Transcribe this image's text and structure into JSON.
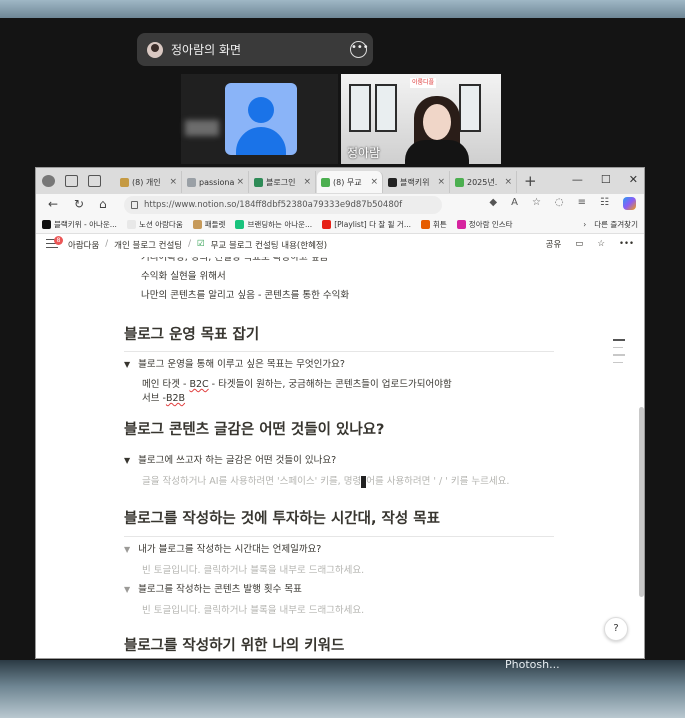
{
  "meeting": {
    "presenter_label": "정아람의 화면",
    "participants": [
      {
        "name": "",
        "type": "avatar"
      },
      {
        "name": "정아람",
        "type": "camera"
      }
    ],
    "sign_text": "이룸디플",
    "taskbar_label": "Photosh..."
  },
  "browser": {
    "tabs": [
      {
        "label": "(8) 개인",
        "color": "#c59a43"
      },
      {
        "label": "passiona",
        "color": "#9aa0a6"
      },
      {
        "label": "블로그인",
        "color": "#2e8b57"
      },
      {
        "label": "(8) 무교",
        "color": "#4caf50",
        "active": true
      },
      {
        "label": "블랙키위",
        "color": "#222222"
      },
      {
        "label": "2025년.",
        "color": "#4caf50"
      }
    ],
    "url": "https://www.notion.so/184ff8dbf52380a79333e9d87b50480f",
    "bookmarks": [
      {
        "label": "블랙키위 - 아나운...",
        "color": "#111111"
      },
      {
        "label": "노션 아람다움",
        "color": "#e8e8e8"
      },
      {
        "label": "패들렛",
        "color": "#c69a5a"
      },
      {
        "label": "브랜딩하는 아나운...",
        "color": "#19c37d"
      },
      {
        "label": "[Playlist] 다 잘 될 거...",
        "color": "#e62117"
      },
      {
        "label": "휘튼",
        "color": "#e65c00"
      },
      {
        "label": "정아람 인스타",
        "color": "#d6249f"
      }
    ],
    "bookmarks_more": "다른 즐겨찾기",
    "window_controls": [
      "—",
      "☐",
      "✕"
    ]
  },
  "notion": {
    "notification_count": "8",
    "breadcrumbs": [
      "아람다움",
      "개인 블로그 컨설팅",
      "무교 블로그 컨설팅 내용(한혜정)"
    ],
    "share_label": "공유",
    "top_lines": [
      "커리어확장, 강의, 컨설팅 목표로 확장하고 싶음",
      "수익화 실현을 위해서",
      "나만의 콘텐츠를 알리고 싶음 - 콘텐츠를 통한 수익화"
    ],
    "section1": {
      "heading": "블로그 운영 목표 잡기",
      "toggle": "블로그 운영을 통해 이루고 싶은 목표는 무엇인가요?",
      "main_target_a": "메인 타겟 - ",
      "main_target_b": "B2C",
      "main_target_c": " - 타겟들이 원하는, 궁금해하는 콘텐츠들이 업로드가되어야함",
      "sub_a": "서브 -",
      "sub_b": "B2B"
    },
    "section2": {
      "heading": "블로그 콘텐츠 글감은 어떤 것들이 있나요?",
      "toggle": "블로그에 쓰고자 하는 글감은 어떤 것들이 있나요?",
      "placeholder_a": "글을 작성하거나 AI를 사용하려면 '스페이스' 키를, 명령",
      "placeholder_b": "어를 사용하려면 ' / ' 키를 누르세요."
    },
    "section3": {
      "heading": "블로그를 작성하는 것에 투자하는 시간대, 작성 목표",
      "toggle1": "내가 블로그를 작성하는 시간대는 언제일까요?",
      "empty1": "빈 토글입니다. 클릭하거나 블록을 내부로 드래그하세요.",
      "toggle2": "블로그를 작성하는 콘텐츠 발행 횟수 목표",
      "empty2": "빈 토글입니다. 클릭하거나 블록을 내부로 드래그하세요."
    },
    "section4": {
      "heading": "블로그를 작성하기 위한 나의 키워드"
    },
    "help_label": "?"
  }
}
